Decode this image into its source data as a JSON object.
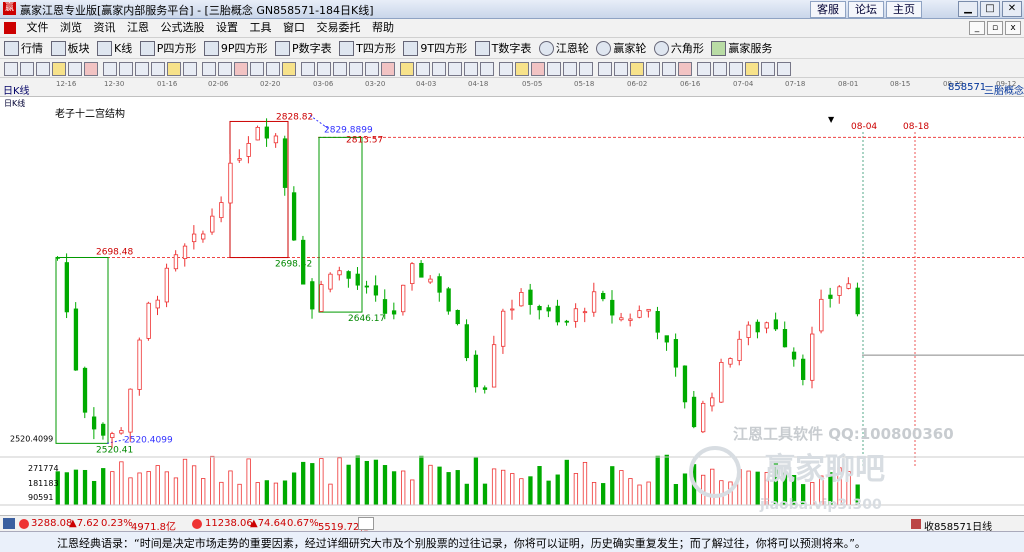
{
  "titlebar": {
    "title": "赢家江恩专业版[赢家内部服务平台] - [三胎概念  GN858571-184日K线]",
    "links": [
      "客服",
      "论坛",
      "主页"
    ]
  },
  "menu": [
    "文件",
    "浏览",
    "资讯",
    "江恩",
    "公式选股",
    "设置",
    "工具",
    "窗口",
    "交易委托",
    "帮助"
  ],
  "toolbar1": [
    "行情",
    "板块",
    "K线",
    "P四方形",
    "9P四方形",
    "P数字表",
    "T四方形",
    "9T四方形",
    "T数字表",
    "江恩轮",
    "赢家轮",
    "六角形",
    "赢家服务"
  ],
  "chart": {
    "period_label": "日K线",
    "indicator_title": "老子十二宫结构",
    "code_label": "858571",
    "name_label": "三胎概念",
    "top_dates": [
      "12-16",
      "12-30",
      "01-16",
      "02-06",
      "02-20",
      "03-06",
      "03-20",
      "04-03",
      "04-18",
      "05-05",
      "05-18",
      "06-02",
      "06-16",
      "07-04",
      "07-18",
      "08-01",
      "08-15",
      "08-29",
      "09-12"
    ],
    "future_dates": [
      "08-04",
      "08-18"
    ],
    "annotations": [
      "2828.82",
      "2829.8899",
      "2813.57",
      "2698.48",
      "2698.42",
      "2646.17",
      "2520.41",
      "2520.4099"
    ],
    "left_price": "2520.4099",
    "volume_labels": [
      "271774",
      "181183",
      "90591"
    ],
    "watermark1": "江恩工具软件  QQ:100800360",
    "watermark2": "赢家聊吧",
    "watermark3": "jiaoba.vip3.300",
    "chart_data": {
      "type": "candlestick",
      "title": "",
      "reference_levels": [
        2828.82,
        2813.57,
        2698.48,
        2698.42,
        2646.17,
        2520.41
      ],
      "last_price_level": 2605,
      "price_range": [
        2515,
        2835
      ],
      "volume_ticks": [
        271774,
        181183,
        90591
      ]
    }
  },
  "status": {
    "sh_index": "3288.08",
    "sh_change": "▲7.62",
    "sh_pct": "0.23%",
    "sh_amount": "4971.8亿",
    "sz_index": "11238.06",
    "sz_change": "▲74.64",
    "sz_pct": "0.67%",
    "sz_amount": "5519.72亿",
    "right_text": "收858571日线"
  },
  "bottom": {
    "quote": "江恩经典语录：“时间是决定市场走势的重要因素，经过详细研究大市及个别股票的过往记录，你将可以证明，历史确实重复发生；而了解过往，你将可以预测将来。”。"
  }
}
